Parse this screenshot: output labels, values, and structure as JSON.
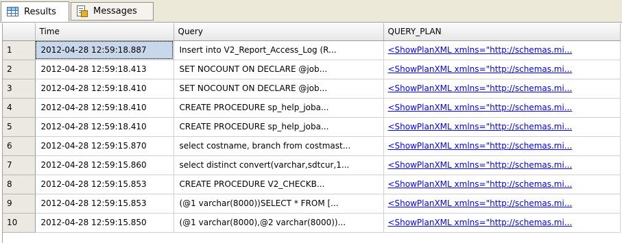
{
  "tabs": [
    {
      "label": "Results",
      "icon": "grid-icon",
      "active": true
    },
    {
      "label": "Messages",
      "icon": "messages-icon",
      "active": false
    }
  ],
  "grid": {
    "columns": [
      "Time",
      "Query",
      "QUERY_PLAN"
    ],
    "rows": [
      {
        "num": "1",
        "time": "2012-04-28 12:59:18.887",
        "query": "Insert into V2_Report_Access_Log (R...",
        "plan": "<ShowPlanXML xmlns=\"http://schemas.mi..."
      },
      {
        "num": "2",
        "time": "2012-04-28 12:59:18.413",
        "query": "SET NOCOUNT ON  DECLARE @job...",
        "plan": "<ShowPlanXML xmlns=\"http://schemas.mi..."
      },
      {
        "num": "3",
        "time": "2012-04-28 12:59:18.410",
        "query": "SET NOCOUNT ON  DECLARE @job...",
        "plan": "<ShowPlanXML xmlns=\"http://schemas.mi..."
      },
      {
        "num": "4",
        "time": "2012-04-28 12:59:18.410",
        "query": "CREATE PROCEDURE sp_help_joba...",
        "plan": "<ShowPlanXML xmlns=\"http://schemas.mi..."
      },
      {
        "num": "5",
        "time": "2012-04-28 12:59:18.410",
        "query": "CREATE PROCEDURE sp_help_joba...",
        "plan": "<ShowPlanXML xmlns=\"http://schemas.mi..."
      },
      {
        "num": "6",
        "time": "2012-04-28 12:59:15.870",
        "query": "select costname, branch from costmast...",
        "plan": "<ShowPlanXML xmlns=\"http://schemas.mi..."
      },
      {
        "num": "7",
        "time": "2012-04-28 12:59:15.860",
        "query": "select distinct convert(varchar,sdtcur,1...",
        "plan": "<ShowPlanXML xmlns=\"http://schemas.mi..."
      },
      {
        "num": "8",
        "time": "2012-04-28 12:59:15.853",
        "query": " CREATE PROCEDURE V2_CHECKB...",
        "plan": "<ShowPlanXML xmlns=\"http://schemas.mi..."
      },
      {
        "num": "9",
        "time": "2012-04-28 12:59:15.853",
        "query": "(@1 varchar(8000))SELECT * FROM [...",
        "plan": "<ShowPlanXML xmlns=\"http://schemas.mi..."
      },
      {
        "num": "10",
        "time": "2012-04-28 12:59:15.850",
        "query": "(@1 varchar(8000),@2 varchar(8000))...",
        "plan": "<ShowPlanXML xmlns=\"http://schemas.mi..."
      }
    ],
    "selected_row": 0,
    "selected_column": "time"
  },
  "colors": {
    "link": "#0000ff",
    "selection": "#c8d8ea",
    "header": "#e8e8e8",
    "row_header": "#ebe9e2",
    "tab_strip": "#ece9d8"
  }
}
